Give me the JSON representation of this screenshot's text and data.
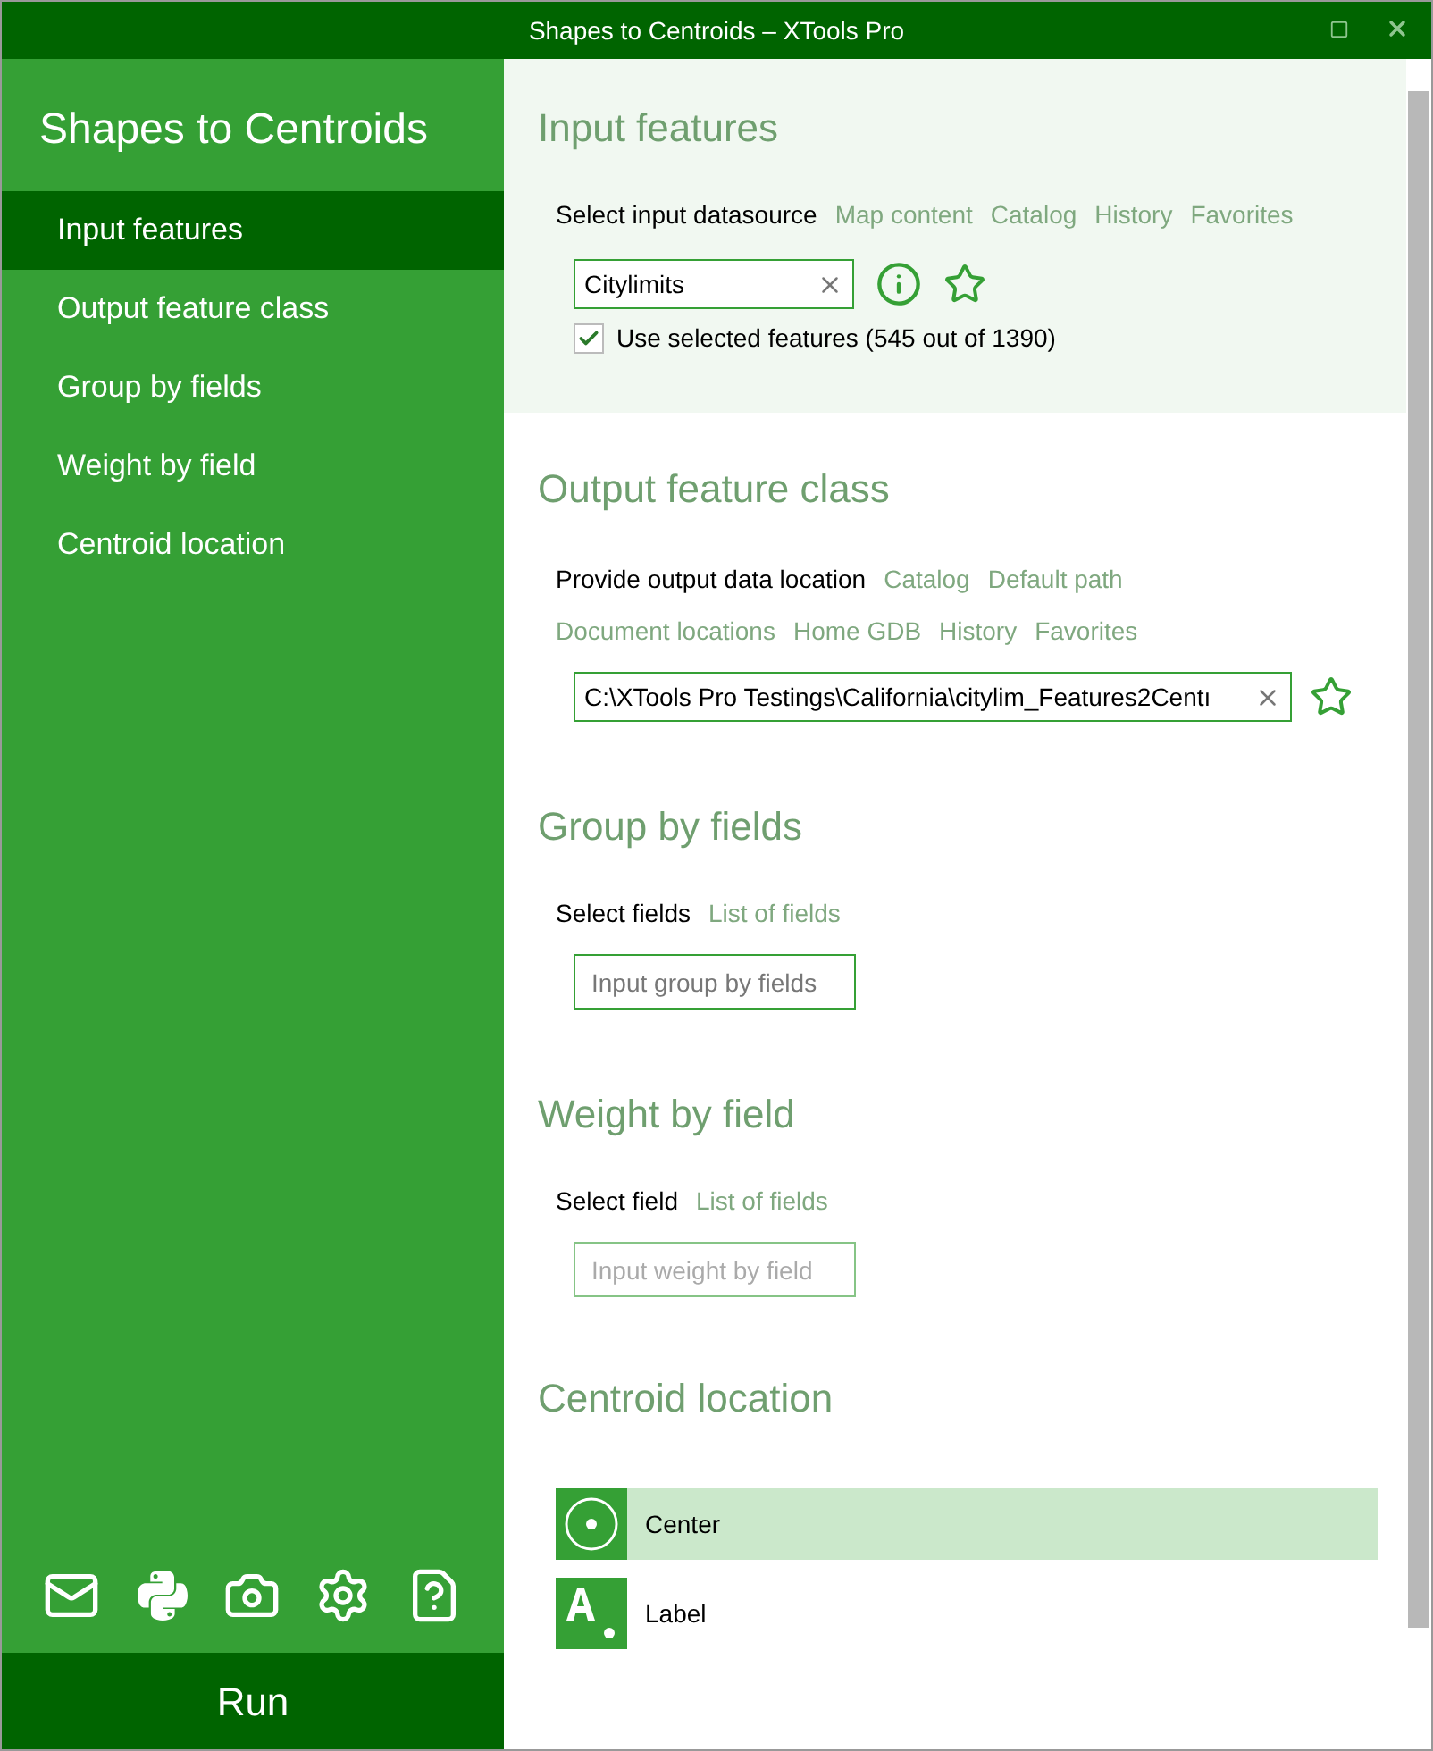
{
  "window": {
    "title": "Shapes to Centroids – XTools Pro"
  },
  "sidebar": {
    "title": "Shapes to Centroids",
    "items": [
      {
        "label": "Input features",
        "selected": true
      },
      {
        "label": "Output feature class",
        "selected": false
      },
      {
        "label": "Group by fields",
        "selected": false
      },
      {
        "label": "Weight by field",
        "selected": false
      },
      {
        "label": "Centroid location",
        "selected": false
      }
    ],
    "run_button": "Run"
  },
  "input_features": {
    "title": "Input features",
    "prompt": "Select input datasource",
    "links": [
      "Map content",
      "Catalog",
      "History",
      "Favorites"
    ],
    "value": "Citylimits",
    "use_selected": {
      "label": "Use selected features (545 out of 1390)",
      "checked": true
    }
  },
  "output_feature_class": {
    "title": "Output feature class",
    "prompt": "Provide output data location",
    "links": [
      "Catalog",
      "Default path",
      "Document locations",
      "Home GDB",
      "History",
      "Favorites"
    ],
    "value": "C:\\XTools Pro Testings\\California\\citylim_Features2Centı"
  },
  "group_by_fields": {
    "title": "Group by fields",
    "prompt": "Select fields",
    "links": [
      "List of fields"
    ],
    "placeholder": "Input group by fields",
    "disabled": false
  },
  "weight_by_field": {
    "title": "Weight by field",
    "prompt": "Select field",
    "links": [
      "List of fields"
    ],
    "placeholder": "Input weight by field",
    "disabled": true
  },
  "centroid_location": {
    "title": "Centroid location",
    "options": [
      {
        "kind": "center",
        "label": "Center",
        "selected": true
      },
      {
        "kind": "label",
        "label": "Label",
        "selected": false
      }
    ]
  }
}
